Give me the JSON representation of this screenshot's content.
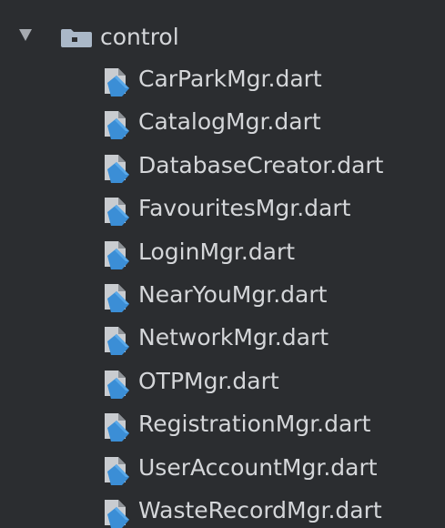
{
  "tree": {
    "folder": {
      "label": "control",
      "icon": "folder-icon",
      "expanded": true
    },
    "files": [
      {
        "label": "CarParkMgr.dart",
        "icon": "dart-file-icon"
      },
      {
        "label": "CatalogMgr.dart",
        "icon": "dart-file-icon"
      },
      {
        "label": "DatabaseCreator.dart",
        "icon": "dart-file-icon"
      },
      {
        "label": "FavouritesMgr.dart",
        "icon": "dart-file-icon"
      },
      {
        "label": "LoginMgr.dart",
        "icon": "dart-file-icon"
      },
      {
        "label": "NearYouMgr.dart",
        "icon": "dart-file-icon"
      },
      {
        "label": "NetworkMgr.dart",
        "icon": "dart-file-icon"
      },
      {
        "label": "OTPMgr.dart",
        "icon": "dart-file-icon"
      },
      {
        "label": "RegistrationMgr.dart",
        "icon": "dart-file-icon"
      },
      {
        "label": "UserAccountMgr.dart",
        "icon": "dart-file-icon"
      },
      {
        "label": "WasteRecordMgr.dart",
        "icon": "dart-file-icon"
      }
    ]
  },
  "colors": {
    "background": "#2b2d30",
    "text": "#d4d6d9",
    "dart_blue": "#3b8ed6",
    "dart_grey": "#c9ccd0"
  }
}
